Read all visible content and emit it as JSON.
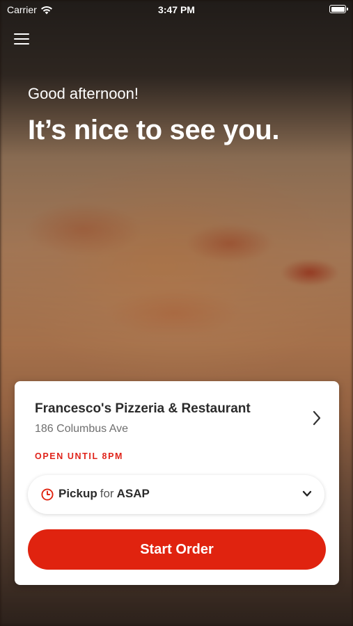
{
  "status_bar": {
    "carrier": "Carrier",
    "time": "3:47 PM",
    "wifi_icon": "wifi-icon",
    "battery_icon": "battery-icon"
  },
  "header": {
    "menu_icon": "hamburger-menu-icon"
  },
  "hero": {
    "greeting": "Good afternoon!",
    "headline": "It’s nice to see you."
  },
  "location_card": {
    "restaurant_name": "Francesco's Pizzeria & Restaurant",
    "address": "186 Columbus Ave",
    "hours_status": "OPEN UNTIL 8PM",
    "chevron_icon": "chevron-right-icon"
  },
  "order_type": {
    "mode": "Pickup",
    "connector": "for",
    "time": "ASAP",
    "clock_icon": "clock-icon",
    "dropdown_icon": "chevron-down-icon"
  },
  "actions": {
    "start_order_label": "Start Order"
  },
  "colors": {
    "accent": "#e0230f",
    "card_background": "#ffffff",
    "text_primary": "#2b2b2b",
    "text_secondary": "#6f6f6f"
  }
}
